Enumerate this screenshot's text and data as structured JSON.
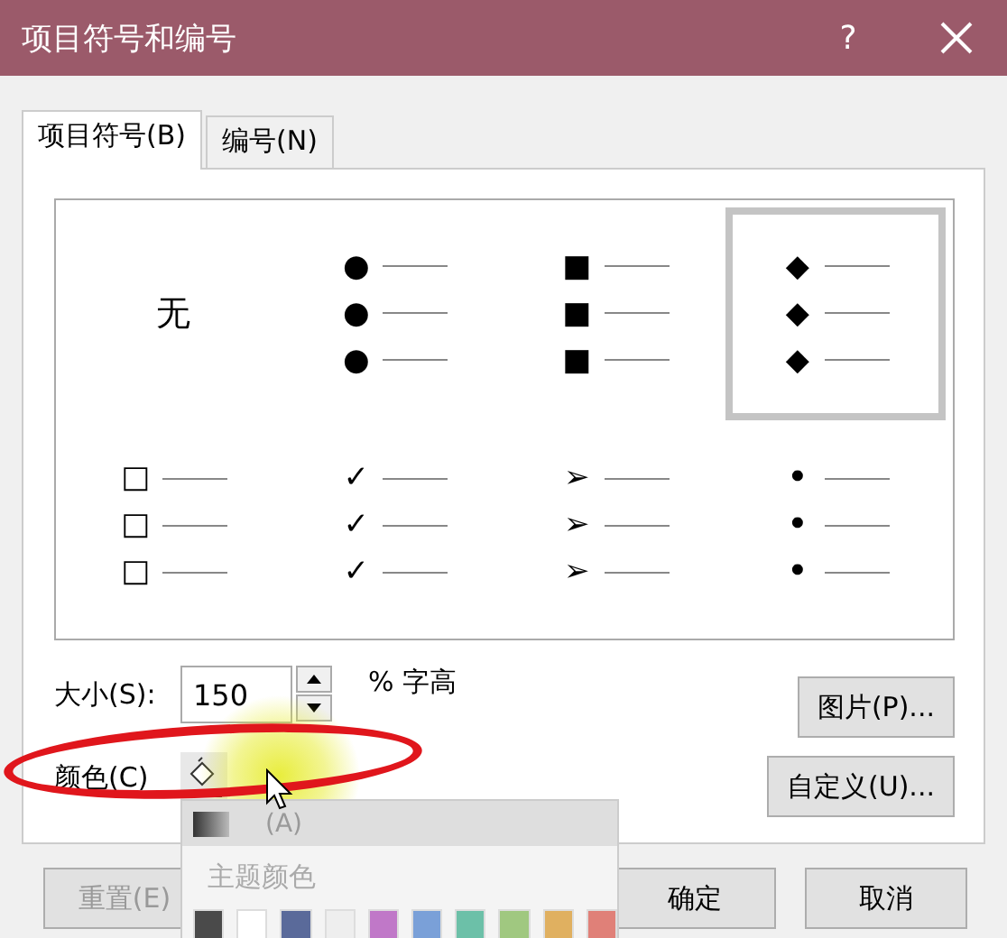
{
  "window": {
    "title": "项目符号和编号",
    "help": "?"
  },
  "tabs": [
    {
      "label": "项目符号(B)",
      "selected": true
    },
    {
      "label": "编号(N)",
      "selected": false
    }
  ],
  "bullet_styles": [
    {
      "kind": "none",
      "label": "无",
      "selected": false
    },
    {
      "kind": "glyph",
      "symbol": "●",
      "selected": false
    },
    {
      "kind": "glyph",
      "symbol": "■",
      "selected": false
    },
    {
      "kind": "glyph",
      "symbol": "◆",
      "selected": true
    },
    {
      "kind": "glyph",
      "symbol": "□",
      "selected": false
    },
    {
      "kind": "glyph",
      "symbol": "✓",
      "selected": false
    },
    {
      "kind": "glyph",
      "symbol": "➢",
      "selected": false
    },
    {
      "kind": "glyph",
      "symbol": "•",
      "selected": false
    }
  ],
  "size": {
    "label": "大小(S):",
    "value": "150",
    "unit": "% 字高"
  },
  "color": {
    "label": "颜色(C)"
  },
  "side_buttons": [
    "图片(P)...",
    "自定义(U)..."
  ],
  "footer_buttons": [
    {
      "label": "重置(E)",
      "disabled": true
    },
    {
      "label": "确定",
      "disabled": false
    },
    {
      "label": "取消",
      "disabled": false
    }
  ],
  "color_menu": {
    "automatic_label": "(A)",
    "theme_heading": "主题颜色",
    "theme_colors": [
      {
        "color": "#4a4a4a"
      },
      {
        "color": "#ffffff"
      },
      {
        "color": "#5a6a9a"
      },
      {
        "color": "#eeeeee"
      },
      {
        "color": "#c078c8"
      },
      {
        "color": "#7aa0d8"
      },
      {
        "color": "#6cc0a8"
      },
      {
        "color": "#a0c880"
      },
      {
        "color": "#e0b060"
      },
      {
        "color": "#e08078"
      }
    ]
  }
}
